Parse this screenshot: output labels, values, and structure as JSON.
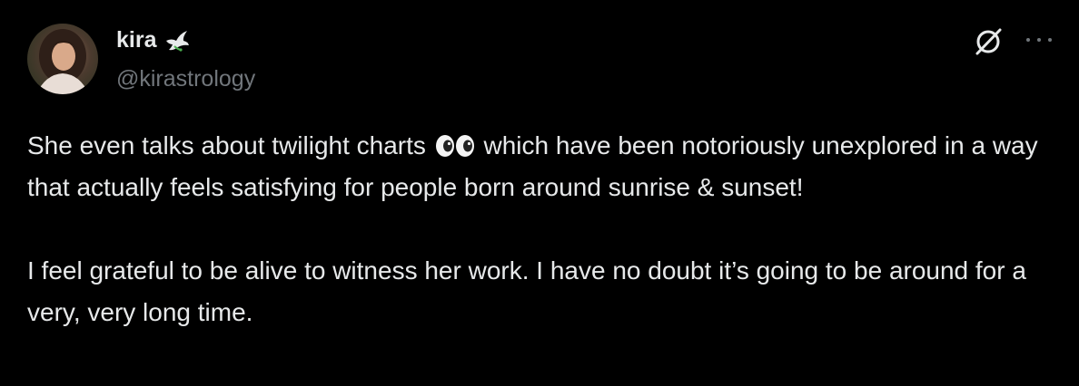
{
  "tweet": {
    "display_name": "kira",
    "handle": "@kirastrology",
    "body": {
      "para1_before": "She even talks about twilight charts ",
      "emoji": "eyes-emoji",
      "para1_after": " which have been notoriously unexplored in a way that actually feels satisfying for people born around sunrise & sunset!",
      "para2": "I feel grateful to be alive to witness her work. I have no doubt it’s going to be around for a very, very long time."
    }
  },
  "icons": {
    "name_badge": "dove-icon",
    "grok": "grok-icon",
    "more": "more-icon"
  },
  "colors": {
    "background": "#000000",
    "primary_text": "#e7e9ea",
    "secondary_text": "#71767b"
  }
}
